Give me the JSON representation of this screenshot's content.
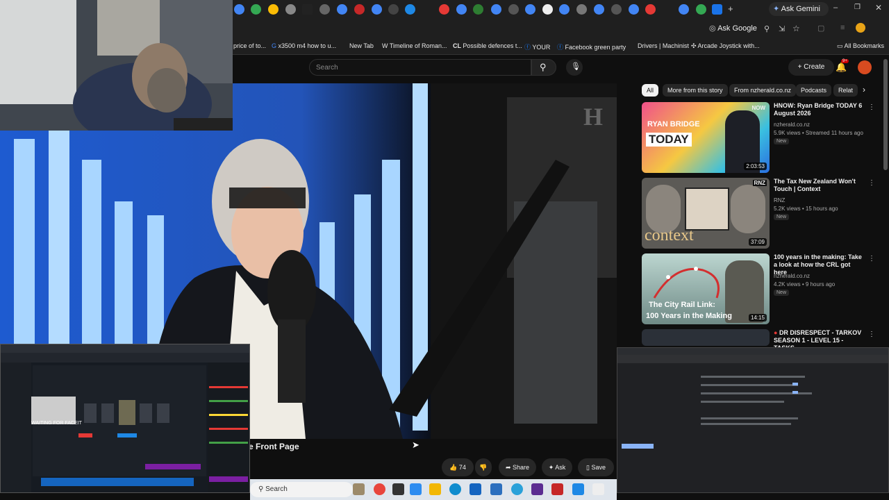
{
  "browser": {
    "ask_gemini": "Ask Gemini",
    "ask_google": "Ask Google",
    "new_tab": "+",
    "bookmarks": [
      "price of to...",
      "x3500 m4 how to u...",
      "New Tab",
      "Timeline of Roman...",
      "Possible defences t...",
      "YOUR",
      "Facebook green party",
      "Drivers | Machinist",
      "Arcade Joystick with...",
      "All Bookmarks"
    ]
  },
  "youtube": {
    "search_placeholder": "Search",
    "create_label": "Create",
    "notif_count": "9+",
    "video_title_fragment": "e Front Page",
    "likes": "74",
    "share": "Share",
    "ask": "Ask",
    "save": "Save",
    "chips": [
      "All",
      "More from this story",
      "From nzherald.co.nz",
      "Podcasts",
      "Relat"
    ],
    "recommendations": [
      {
        "title": "HNOW: Ryan Bridge TODAY 6 August 2026",
        "channel": "nzherald.co.nz",
        "meta": "5.9K views • Streamed 11 hours ago",
        "badge": "New",
        "duration": "2:03:53",
        "thumb_line1": "RYAN BRIDGE",
        "thumb_line2": "TODAY",
        "thumb_tag": "NOW"
      },
      {
        "title": "The Tax New Zealand Won't Touch | Context",
        "channel": "RNZ",
        "meta": "5.2K views • 15 hours ago",
        "badge": "New",
        "duration": "37:09",
        "thumb_line1": "context",
        "thumb_tag": "RNZ"
      },
      {
        "title": "100 years in the making: Take a look at how the CRL got here",
        "channel": "nzherald.co.nz",
        "meta": "4.2K views • 9 hours ago",
        "badge": "New",
        "duration": "14:15",
        "thumb_line1": "The City Rail Link:",
        "thumb_line2": "100 Years in the Making"
      },
      {
        "title": "DR DISRESPECT - TARKOV SEASON 1 - LEVEL 15 - TASKS ..."
      }
    ]
  },
  "overlay": {
    "waiting": "WAITING FOR FACEIT"
  },
  "taskbar": {
    "search": "Search"
  },
  "colors": {
    "yt_bg": "#0f0f0f",
    "red": "#ff0000",
    "accent_gemini": "#8ab4f8"
  }
}
